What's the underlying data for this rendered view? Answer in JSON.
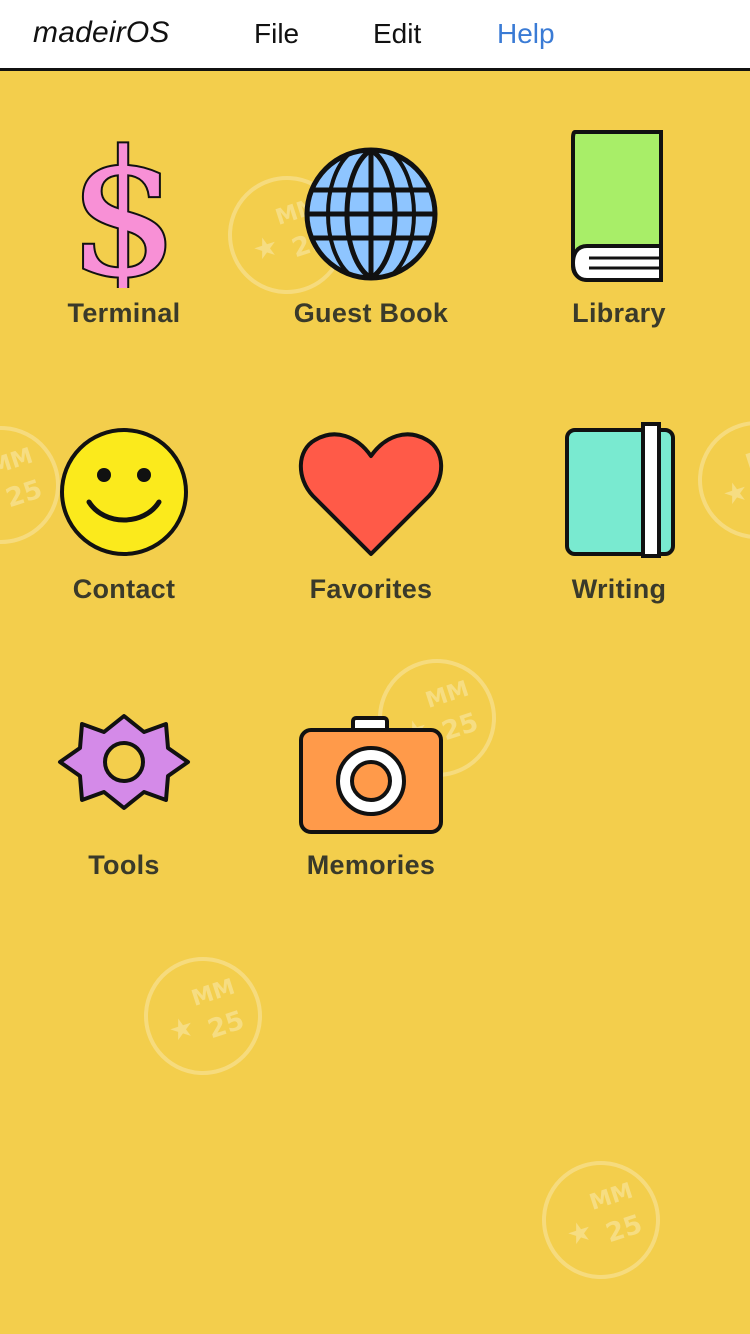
{
  "menubar": {
    "brand": "madeirOS",
    "file_label": "File",
    "edit_label": "Edit",
    "help_label": "Help",
    "help_color": "#3a7bd5"
  },
  "background_color": "#f3ce4c",
  "stamps": {
    "star": "★",
    "mm": "MM",
    "number": "25"
  },
  "apps": [
    {
      "label": "Terminal",
      "icon": "dollar-icon",
      "color": "#f890d6"
    },
    {
      "label": "Guest Book",
      "icon": "globe-icon",
      "color": "#8ec5ff"
    },
    {
      "label": "Library",
      "icon": "book-icon",
      "color": "#a8ee68"
    },
    {
      "label": "Contact",
      "icon": "smiley-icon",
      "color": "#fbea1c"
    },
    {
      "label": "Favorites",
      "icon": "heart-icon",
      "color": "#ff5a48"
    },
    {
      "label": "Writing",
      "icon": "notebook-icon",
      "color": "#79ead0"
    },
    {
      "label": "Tools",
      "icon": "gear-icon",
      "color": "#d48ae8"
    },
    {
      "label": "Memories",
      "icon": "camera-icon",
      "color": "#ff9a4a"
    }
  ]
}
